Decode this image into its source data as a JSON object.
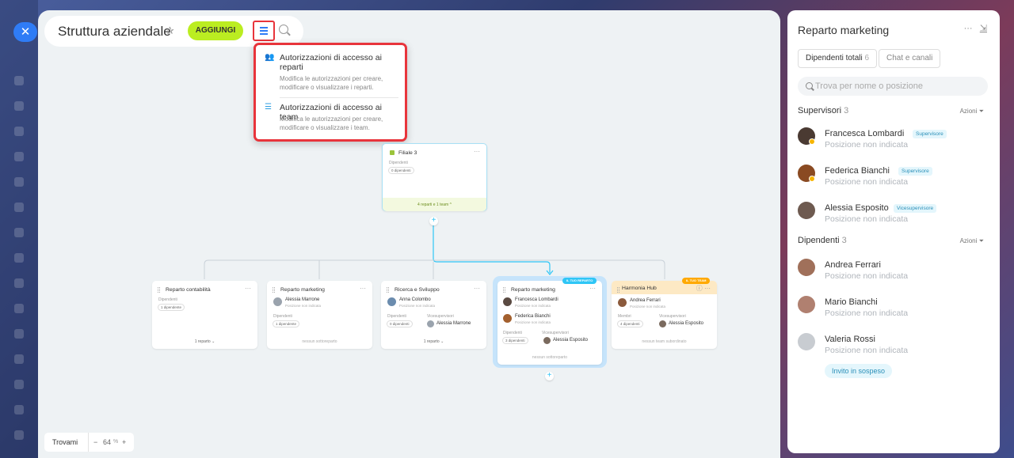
{
  "close_icon": "close-icon",
  "header": {
    "title": "Struttura aziendale",
    "add_label": "AGGIUNGI"
  },
  "dropdown": {
    "items": [
      {
        "title": "Autorizzazioni di accesso ai reparti",
        "desc": "Modifica le autorizzazioni per creare, modificare o visualizzare i reparti."
      },
      {
        "title": "Autorizzazioni di accesso ai team",
        "desc": "Modifica le autorizzazioni per creare, modificare o visualizzare i team."
      }
    ]
  },
  "root_card": {
    "title": "Filiale 3",
    "label": "Dipendenti",
    "count": "0 dipendenti",
    "footer": "4 reparti e 1 team ^"
  },
  "cards": {
    "c1": {
      "title": "Reparto contabilità",
      "label": "Dipendenti",
      "count": "1 dipendente",
      "footer": "1 reparto ⌄"
    },
    "c2": {
      "title": "Reparto marketing",
      "head_name": "Alessia Marrone",
      "head_pos": "Posizione non indicata",
      "label": "Dipendenti",
      "count": "1 dipendente",
      "footer": "nessun sottoreparto"
    },
    "c3": {
      "title": "Ricerca e Sviluppo",
      "head_name": "Anna Colombo",
      "head_pos": "Posizione non indicata",
      "label": "Dipendenti",
      "count": "0 dipendenti",
      "deputy_label": "Vicesupervisori",
      "deputy": "Alessia Marrone",
      "footer": "1 reparto ⌄"
    },
    "c4": {
      "title": "Reparto marketing",
      "badge": "IL TUO REPARTO",
      "h1_name": "Francesca Lombardi",
      "h1_pos": "Posizione non indicata",
      "h2_name": "Federica Bianchi",
      "h2_pos": "Posizione non indicata",
      "label": "Dipendenti",
      "count": "3 dipendenti",
      "deputy_label": "Vicesupervisori",
      "deputy": "Alessia Esposito",
      "footer": "nessun sottoreparto"
    },
    "c5": {
      "title": "Harmonia Hub",
      "badge": "IL TUO TEAM",
      "head_name": "Andrea Ferrari",
      "head_pos": "Posizione non indicata",
      "label": "Membri",
      "count": "4 dipendenti",
      "deputy_label": "Vicesupervisori",
      "deputy": "Alessia Esposito",
      "footer": "nessun team subordinato"
    }
  },
  "zoom": {
    "find_label": "Trovami",
    "minus": "−",
    "value": "64",
    "unit": "%",
    "plus": "+"
  },
  "panel": {
    "title": "Reparto marketing",
    "tab_employees": "Dipendenti totali",
    "tab_employees_count": "6",
    "tab_chats": "Chat e canali",
    "search_placeholder": "Trova per nome o posizione",
    "supervisors_title": "Supervisori",
    "supervisors_count": "3",
    "actions": "Azioni",
    "employees_title": "Dipendenti",
    "employees_count": "3",
    "supervisors": [
      {
        "name": "Francesca Lombardi",
        "badge": "Supervisore",
        "pos": "Posizione non indicata"
      },
      {
        "name": "Federica Bianchi",
        "badge": "Supervisore",
        "pos": "Posizione non indicata"
      },
      {
        "name": "Alessia Esposito",
        "badge": "Vicesupervisore",
        "pos": "Posizione non indicata"
      }
    ],
    "employees": [
      {
        "name": "Andrea Ferrari",
        "pos": "Posizione non indicata"
      },
      {
        "name": "Mario Bianchi",
        "pos": "Posizione non indicata"
      },
      {
        "name": "Valeria Rossi",
        "pos": "Posizione non indicata",
        "invite": "Invito in sospeso"
      }
    ]
  },
  "colors": {
    "accent_blue": "#2f7cf6",
    "add_green": "#bbed21",
    "highlight_red": "#e8343b",
    "connector": "#2fc6f6",
    "team_orange": "#ffa900"
  }
}
